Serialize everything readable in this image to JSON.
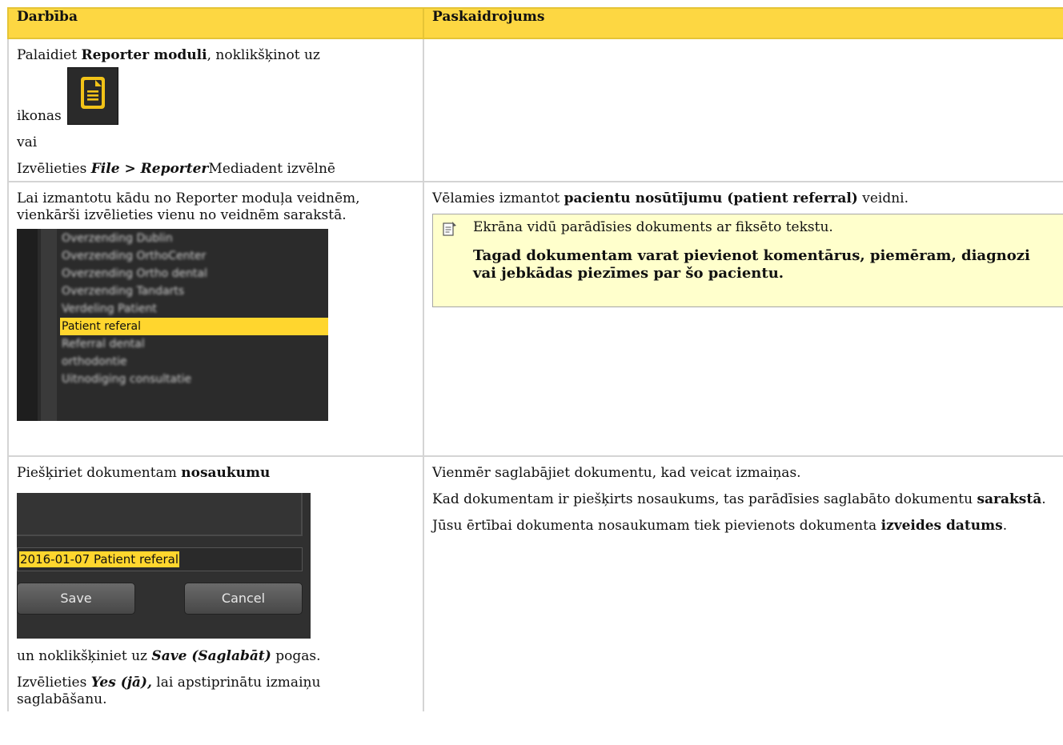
{
  "table": {
    "col1_header": "Darbība",
    "col2_header": "Paskaidrojums"
  },
  "row1": {
    "a_pre": "Palaidiet ",
    "a_bold": "Reporter moduli",
    "a_post": ", noklikšķinot uz",
    "b": "ikonas",
    "c": "vai",
    "d_pre": "Izvēlieties ",
    "d_file": "File",
    "d_sep": " > ",
    "d_reporter": "Reporter",
    "d_post": "Mediadent izvēlnē"
  },
  "row2": {
    "left_text": "Lai izmantotu kādu no Reporter moduļa veidnēm, vienkārši izvēlieties vienu no veidnēm sarakstā.",
    "list_items": [
      "Overzending Dublin",
      "Overzending OrthoCenter",
      "Overzending Ortho dental",
      "Overzending Tandarts",
      "Verdeling Patient"
    ],
    "list_selected": "Patient referal",
    "list_items_after": [
      "Referral dental",
      "orthodontie",
      "Uitnodiging consultatie"
    ],
    "right_pre": "Vēlamies izmantot ",
    "right_bold": "pacientu nosūtījumu (patient referral)",
    "right_post": " veidni.",
    "note_line1": "Ekrāna vidū parādīsies dokuments ar fiksēto tekstu.",
    "note_line2": "Tagad dokumentam varat pievienot komentārus, piemēram, diagnozi vai jebkādas piezīmes par šo pacientu."
  },
  "row3": {
    "left_pre": "Piešķiriet dokumentam ",
    "left_bold": "nosaukumu",
    "field_value": "2016-01-07 Patient referal",
    "save_btn": "Save",
    "cancel_btn": "Cancel",
    "click_pre": "un noklikšķiniet uz ",
    "click_bold": "Save (Saglabāt)",
    "click_post": " pogas.",
    "yes_pre": "Izvēlieties ",
    "yes_bold": "Yes (jā),",
    "yes_post": " lai apstiprinātu izmaiņu saglabāšanu.",
    "right_p1": "Vienmēr saglabājiet dokumentu, kad veicat izmaiņas.",
    "right_p2_pre": "Kad dokumentam ir piešķirts nosaukums, tas parādīsies saglabāto dokumentu ",
    "right_p2_bold": "sarakstā",
    "right_p2_post": ".",
    "right_p3_pre": "Jūsu ērtībai dokumenta nosaukumam tiek pievienots dokumenta ",
    "right_p3_bold": "izveides datums",
    "right_p3_post": "."
  },
  "icons": {
    "reporter": "document-icon",
    "note": "note-icon"
  },
  "colors": {
    "header_bg": "#fdd742",
    "note_bg": "#ffffcc",
    "selection": "#ffd62e"
  }
}
